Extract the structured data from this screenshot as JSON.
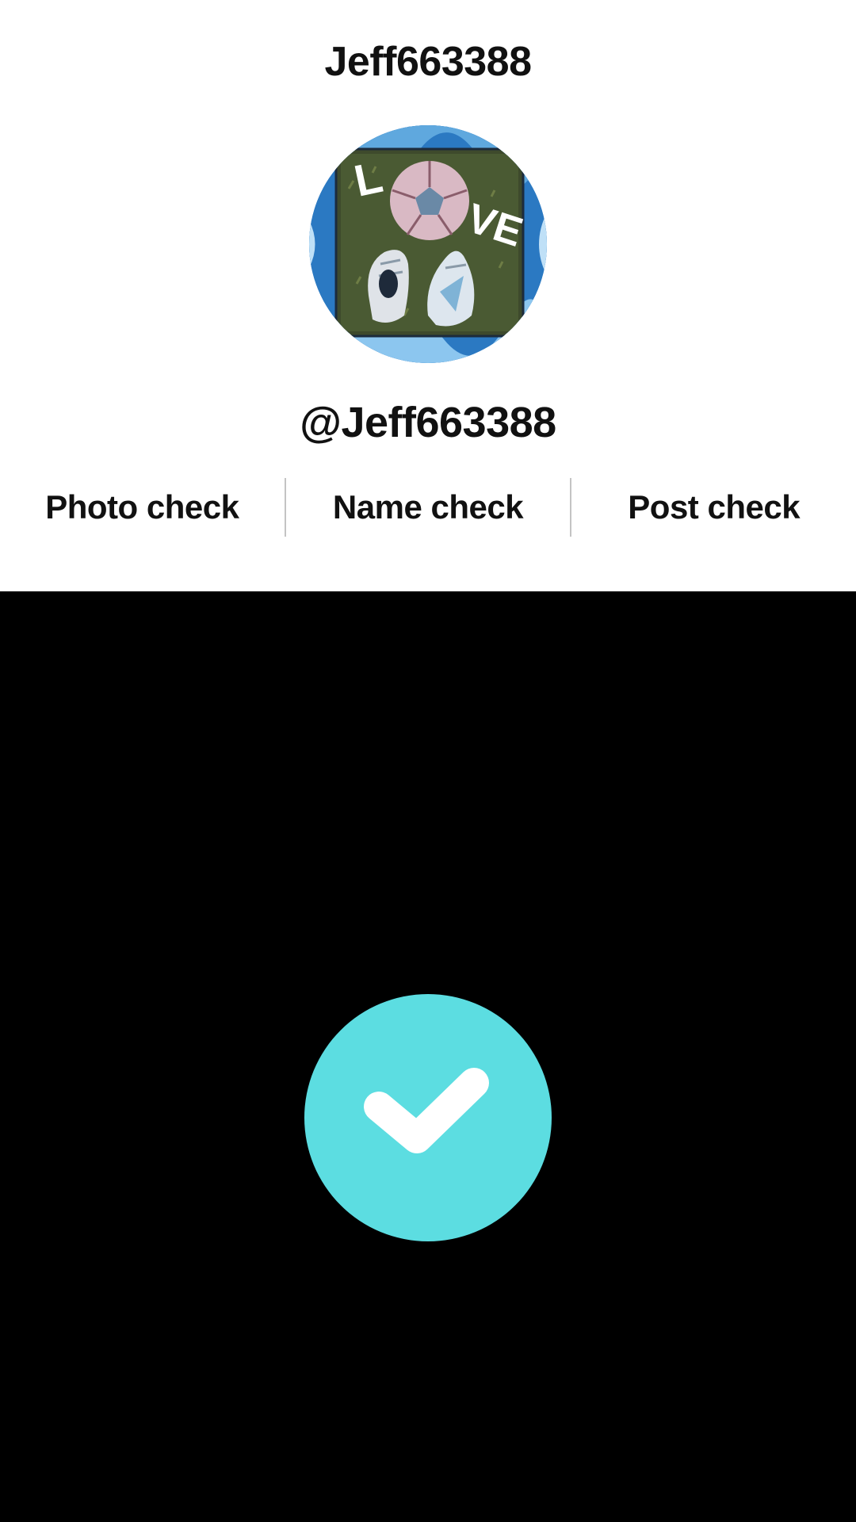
{
  "profile": {
    "display_name": "Jeff663388",
    "username": "@Jeff663388",
    "avatar": {
      "icon": "profile-photo",
      "overlay_text": [
        "L",
        "VE"
      ]
    }
  },
  "checks": [
    {
      "label": "Photo check"
    },
    {
      "label": "Name check"
    },
    {
      "label": "Post check"
    }
  ],
  "verification": {
    "icon": "checkmark-icon",
    "color": "#5cdde1"
  },
  "colors": {
    "top_background": "#ffffff",
    "bottom_background": "#000000",
    "text": "#111111"
  }
}
